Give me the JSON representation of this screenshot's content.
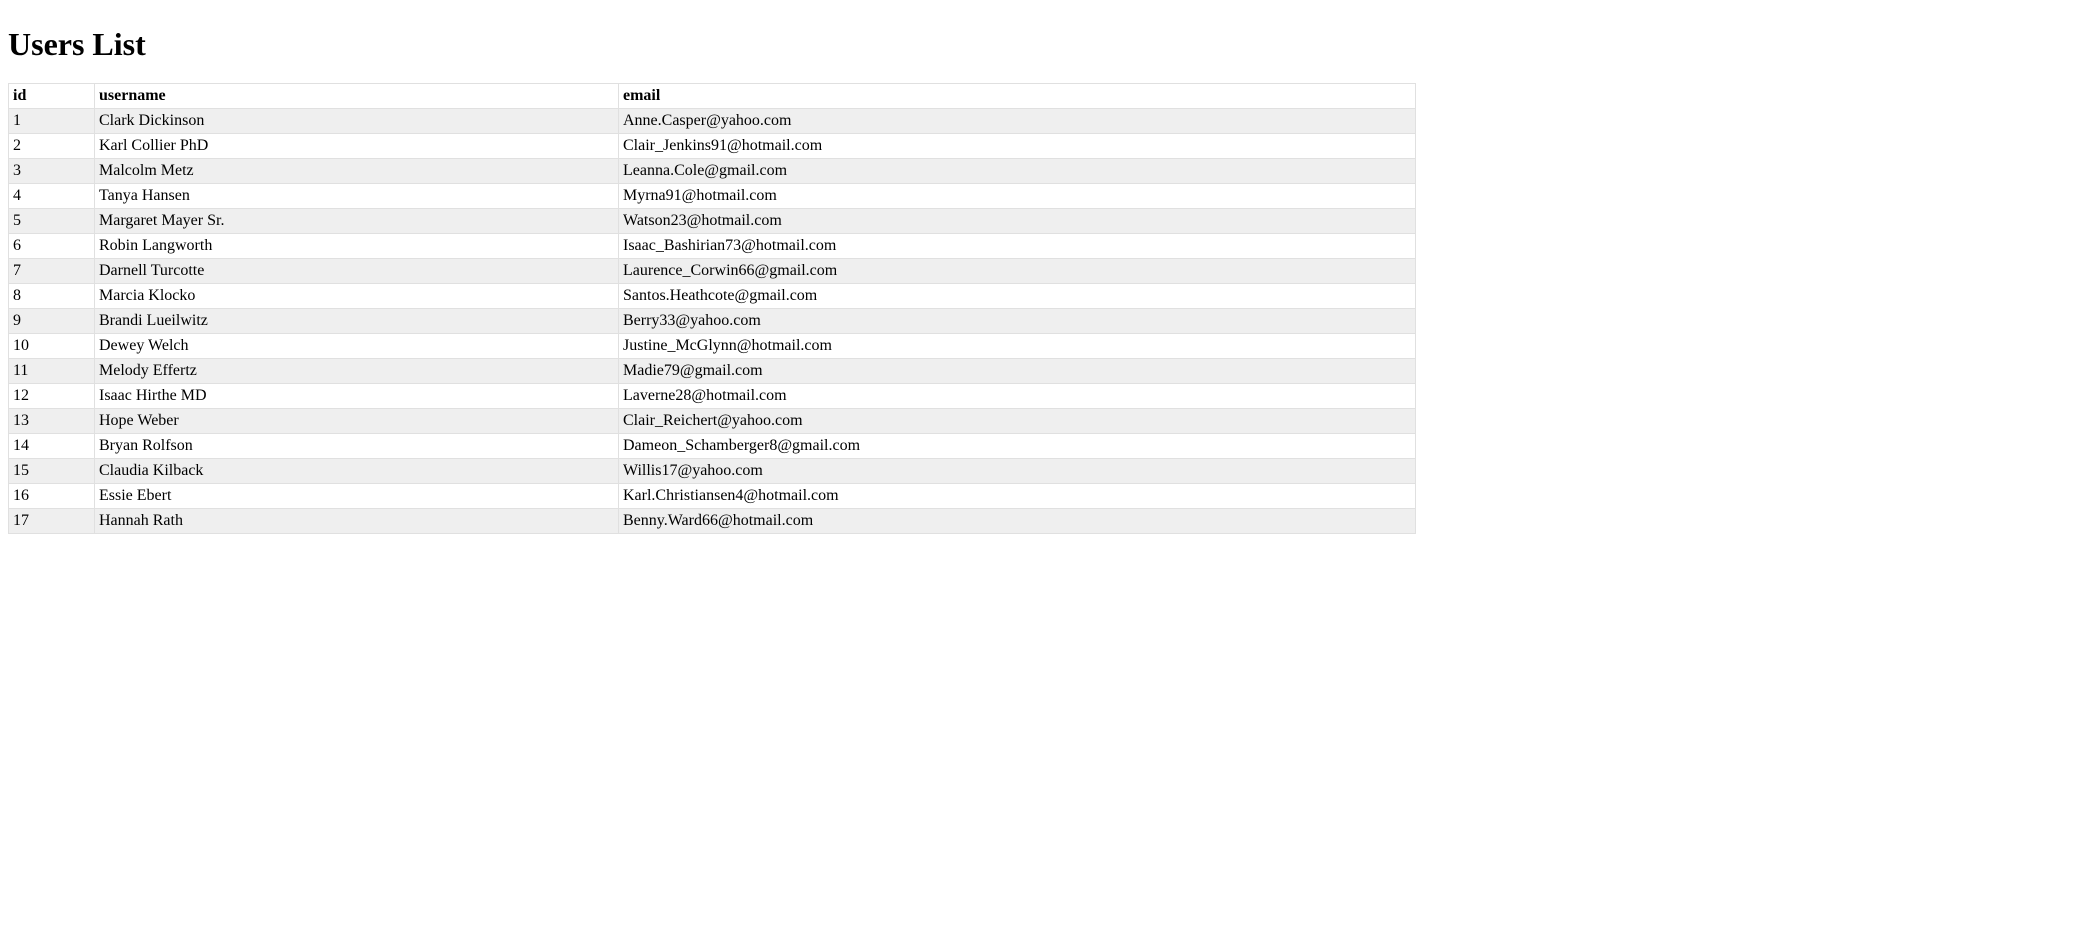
{
  "title": "Users List",
  "columns": [
    "id",
    "username",
    "email"
  ],
  "rows": [
    {
      "id": "1",
      "username": "Clark Dickinson",
      "email": "Anne.Casper@yahoo.com"
    },
    {
      "id": "2",
      "username": "Karl Collier PhD",
      "email": "Clair_Jenkins91@hotmail.com"
    },
    {
      "id": "3",
      "username": "Malcolm Metz",
      "email": "Leanna.Cole@gmail.com"
    },
    {
      "id": "4",
      "username": "Tanya Hansen",
      "email": "Myrna91@hotmail.com"
    },
    {
      "id": "5",
      "username": "Margaret Mayer Sr.",
      "email": "Watson23@hotmail.com"
    },
    {
      "id": "6",
      "username": "Robin Langworth",
      "email": "Isaac_Bashirian73@hotmail.com"
    },
    {
      "id": "7",
      "username": "Darnell Turcotte",
      "email": "Laurence_Corwin66@gmail.com"
    },
    {
      "id": "8",
      "username": "Marcia Klocko",
      "email": "Santos.Heathcote@gmail.com"
    },
    {
      "id": "9",
      "username": "Brandi Lueilwitz",
      "email": "Berry33@yahoo.com"
    },
    {
      "id": "10",
      "username": "Dewey Welch",
      "email": "Justine_McGlynn@hotmail.com"
    },
    {
      "id": "11",
      "username": "Melody Effertz",
      "email": "Madie79@gmail.com"
    },
    {
      "id": "12",
      "username": "Isaac Hirthe MD",
      "email": "Laverne28@hotmail.com"
    },
    {
      "id": "13",
      "username": "Hope Weber",
      "email": "Clair_Reichert@yahoo.com"
    },
    {
      "id": "14",
      "username": "Bryan Rolfson",
      "email": "Dameon_Schamberger8@gmail.com"
    },
    {
      "id": "15",
      "username": "Claudia Kilback",
      "email": "Willis17@yahoo.com"
    },
    {
      "id": "16",
      "username": "Essie Ebert",
      "email": "Karl.Christiansen4@hotmail.com"
    },
    {
      "id": "17",
      "username": "Hannah Rath",
      "email": "Benny.Ward66@hotmail.com"
    }
  ]
}
